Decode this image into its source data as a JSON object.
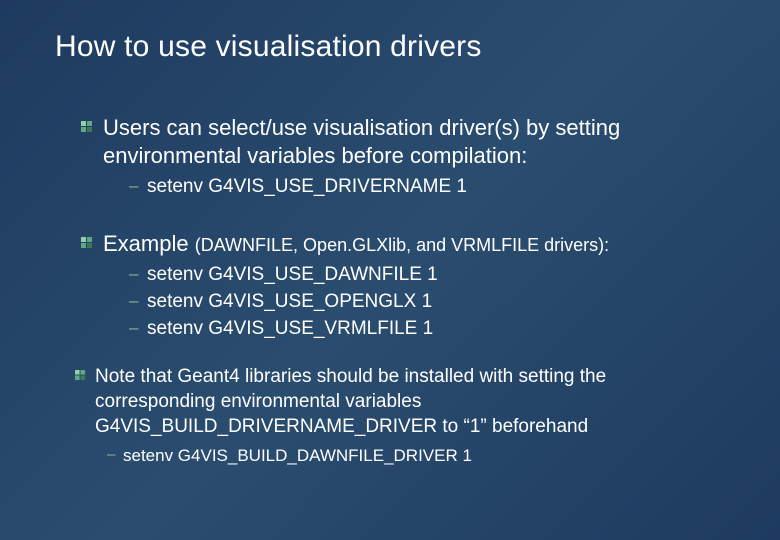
{
  "title": "How to use visualisation drivers",
  "bullet1": {
    "text": "Users can select/use visualisation driver(s) by setting environmental variables before compilation:",
    "sub": [
      "setenv G4VIS_USE_DRIVERNAME 1"
    ]
  },
  "bullet2": {
    "lead": "Example ",
    "paren": "(DAWNFILE, Open.GLXlib, and VRMLFILE drivers):",
    "sub": [
      "setenv G4VIS_USE_DAWNFILE 1",
      "setenv G4VIS_USE_OPENGLX   1",
      "setenv G4VIS_USE_VRMLFILE  1"
    ]
  },
  "bullet3": {
    "text": "Note that Geant4 libraries should be installed with setting the corresponding environmental variables G4VIS_BUILD_DRIVERNAME_DRIVER to “1” beforehand",
    "sub": [
      "setenv G4VIS_BUILD_DAWNFILE_DRIVER 1"
    ]
  }
}
